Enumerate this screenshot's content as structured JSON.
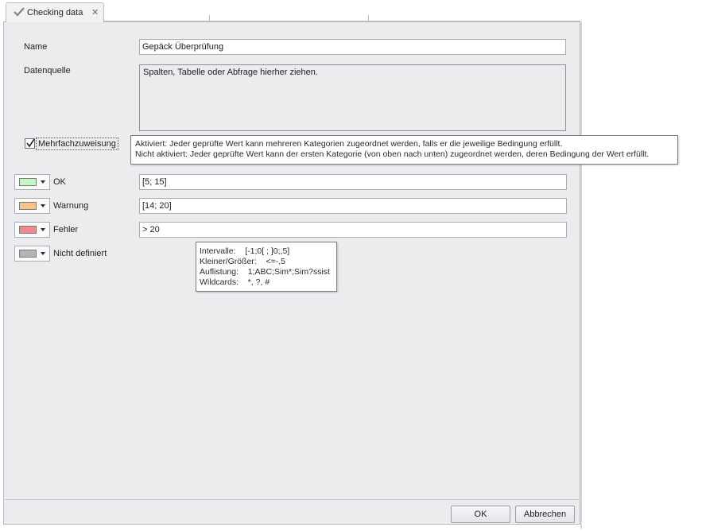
{
  "tab": {
    "title": "Checking data",
    "close_glyph": "✕",
    "icon": "checkmark-icon"
  },
  "form": {
    "name_label": "Name",
    "name_value": "Gepäck Überprüfung",
    "source_label": "Datenquelle",
    "source_placeholder": "Spalten, Tabelle oder Abfrage hierher ziehen.",
    "multi_assign_label": "Mehrfachzuweisung",
    "multi_assign_checked": true
  },
  "tooltip_multi": {
    "line1": "Aktiviert: Jeder geprüfte Wert kann mehreren Kategorien zugeordnet werden, falls er die jeweilige Bedingung erfüllt.",
    "line2": "Nicht aktiviert: Jeder geprüfte Wert kann der ersten Kategorie (von oben nach unten) zugeordnet werden, deren Bedingung der Wert erfüllt."
  },
  "categories": [
    {
      "label": "OK",
      "value": "[5; 15]",
      "color": "#c6f7c6"
    },
    {
      "label": "Warnung",
      "value": "[14; 20]",
      "color": "#f9c48a"
    },
    {
      "label": "Fehler",
      "value": "> 20",
      "color": "#f08a8a"
    },
    {
      "label": "Nicht definiert",
      "value": "",
      "color": "#b4b4b4"
    }
  ],
  "tooltip_syntax": {
    "rows": [
      "Intervalle:    [-1;0[ ; ]0;,5]",
      "Kleiner/Größer:    <=-,5",
      "Auflistung:    1;ABC;Sim*;Sim?ssist",
      "Wildcards:    *, ?, #"
    ]
  },
  "buttons": {
    "ok": "OK",
    "cancel": "Abbrechen"
  }
}
